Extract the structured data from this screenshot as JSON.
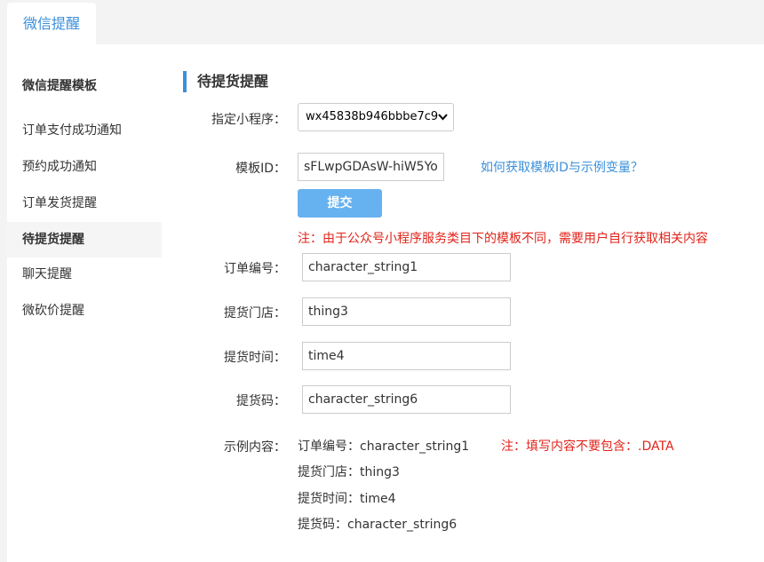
{
  "tabs": [
    {
      "label": "微信提醒"
    }
  ],
  "sidebar": {
    "title": "微信提醒模板",
    "items": [
      {
        "label": "订单支付成功通知"
      },
      {
        "label": "预约成功通知"
      },
      {
        "label": "订单发货提醒"
      },
      {
        "label": "待提货提醒"
      },
      {
        "label": "聊天提醒"
      },
      {
        "label": "微砍价提醒"
      }
    ]
  },
  "main": {
    "heading": "待提货提醒",
    "miniprogram": {
      "label": "指定小程序：",
      "value": "wx45838b946bbbe7c9"
    },
    "template_id": {
      "label": "模板ID：",
      "value": "sFLwpGDAsW-hiW5Yo"
    },
    "help_link": "如何获取模板ID与示例变量？",
    "submit": "提交",
    "notice": "注：由于公众号小程序服务类目下的模板不同，需要用户自行获取相关内容",
    "fields": [
      {
        "label": "订单编号：",
        "value": "character_string1"
      },
      {
        "label": "提货门店：",
        "value": "thing3"
      },
      {
        "label": "提货时间：",
        "value": "time4"
      },
      {
        "label": "提货码：",
        "value": "character_string6"
      }
    ],
    "example": {
      "label": "示例内容：",
      "lines": [
        "订单编号：character_string1",
        "提货门店：thing3",
        "提货时间：time4",
        "提货码：character_string6"
      ],
      "note": "注：填写内容不要包含：.DATA"
    }
  },
  "colors": {
    "accent": "#3b8fd9",
    "button": "#66b1f0",
    "warning": "#e2231a"
  }
}
